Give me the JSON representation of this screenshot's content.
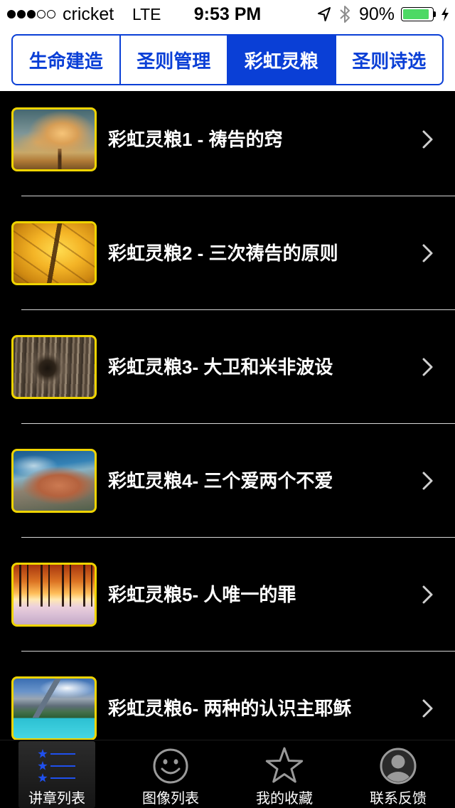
{
  "status_bar": {
    "signal_strength": 3,
    "signal_max": 5,
    "carrier": "cricket",
    "network": "LTE",
    "time": "9:53 PM",
    "battery_text": "90%",
    "battery_level": 0.9,
    "location_icon": "location-arrow-icon",
    "bluetooth_icon": "bluetooth-icon",
    "charging_icon": "charging-bolt-icon"
  },
  "segments": {
    "items": [
      {
        "label": "生命建造",
        "selected": false
      },
      {
        "label": "圣则管理",
        "selected": false
      },
      {
        "label": "彩虹灵粮",
        "selected": true
      },
      {
        "label": "圣则诗选",
        "selected": false
      }
    ]
  },
  "list": {
    "accessory_icon": "chevron-right-icon",
    "items": [
      {
        "title": "彩虹灵粮1 - 祷告的窍"
      },
      {
        "title": "彩虹灵粮2 - 三次祷告的原则"
      },
      {
        "title": "彩虹灵粮3- 大卫和米非波设"
      },
      {
        "title": "彩虹灵粮4- 三个爱两个不爱"
      },
      {
        "title": "彩虹灵粮5- 人唯一的罪"
      },
      {
        "title": "彩虹灵粮6- 两种的认识主耶稣"
      }
    ]
  },
  "tab_bar": {
    "items": [
      {
        "label": "讲章列表",
        "icon": "starred-list-icon",
        "selected": true
      },
      {
        "label": "图像列表",
        "icon": "smiley-icon",
        "selected": false
      },
      {
        "label": "我的收藏",
        "icon": "star-icon",
        "selected": false
      },
      {
        "label": "联系反馈",
        "icon": "contact-icon",
        "selected": false
      }
    ]
  },
  "colors": {
    "accent": "#0a3fd6",
    "tab_selected": "#1f50ee",
    "thumbnail_border": "#efd400",
    "battery_fill": "#4cd964",
    "icon_inactive": "#9a9a9a"
  }
}
